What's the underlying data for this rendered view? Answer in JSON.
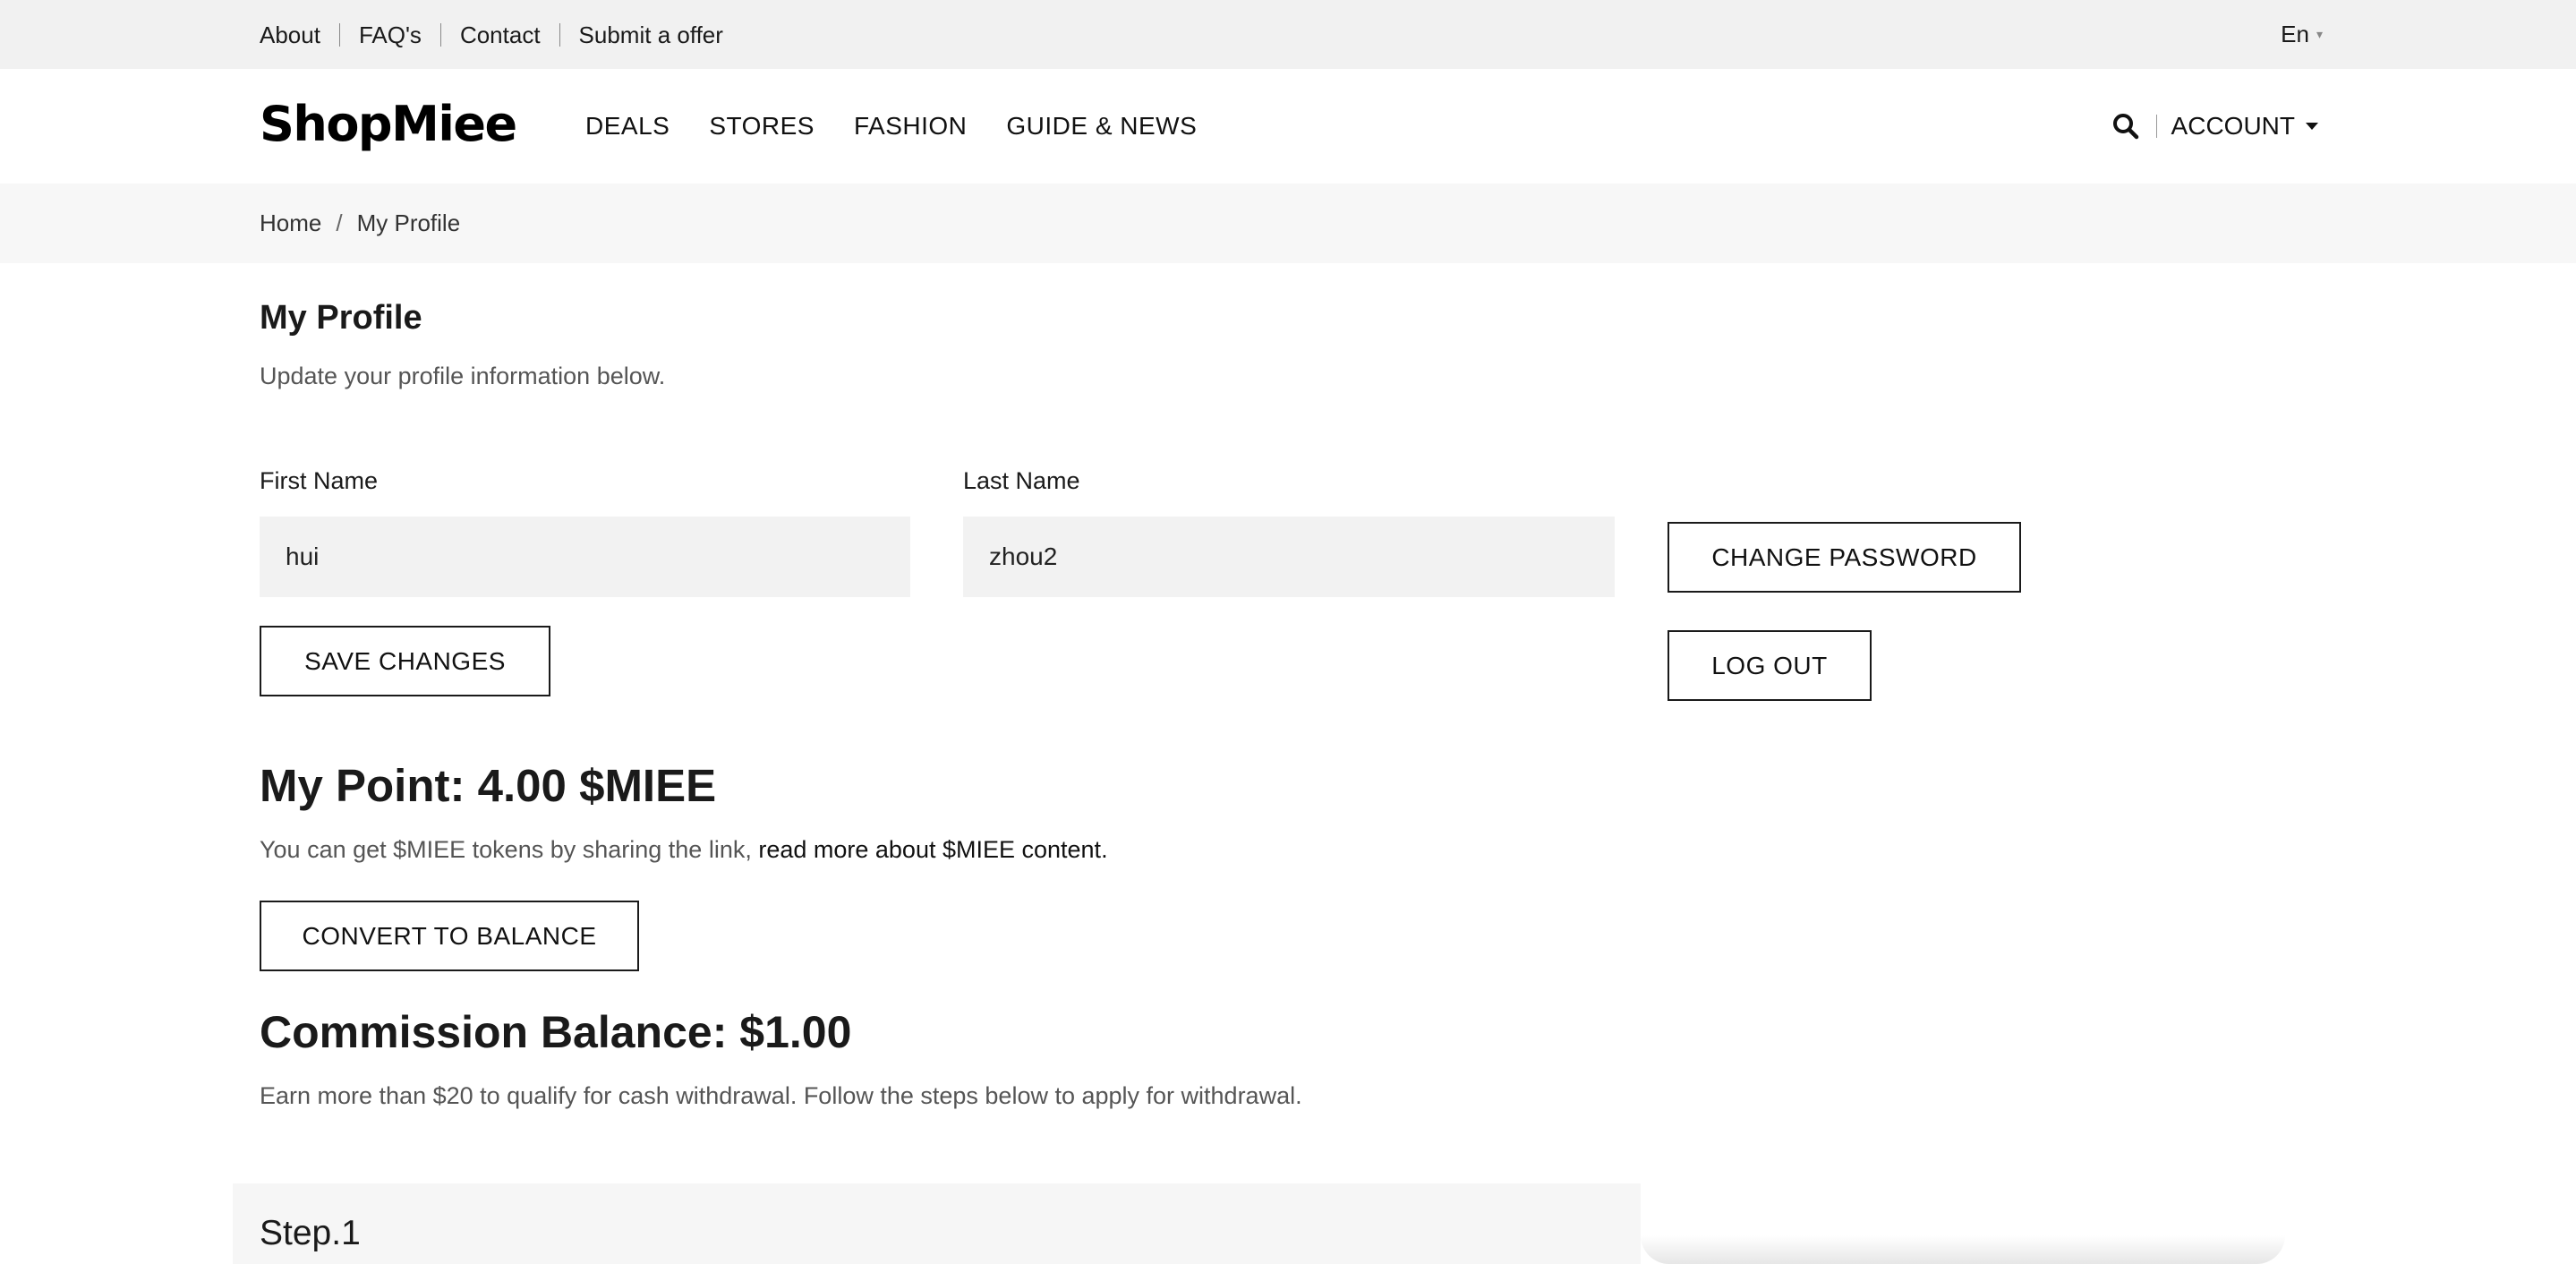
{
  "topbar": {
    "links": [
      "About",
      "FAQ's",
      "Contact",
      "Submit a offer"
    ],
    "language": "En"
  },
  "header": {
    "logo": "ShopMiee",
    "nav": [
      "DEALS",
      "STORES",
      "FASHION",
      "GUIDE & NEWS"
    ],
    "account_label": "ACCOUNT",
    "icons": [
      "search-icon",
      "caret-down-icon"
    ]
  },
  "breadcrumb": {
    "home": "Home",
    "separator": "/",
    "current": "My Profile"
  },
  "profile": {
    "title": "My Profile",
    "subtitle": "Update your profile information below.",
    "first_name_label": "First Name",
    "first_name_value": "hui",
    "last_name_label": "Last Name",
    "last_name_value": "zhou2",
    "save_button": "SAVE CHANGES",
    "change_password_button": "CHANGE PASSWORD",
    "logout_button": "LOG OUT"
  },
  "points": {
    "title": "My Point: 4.00 $MIEE",
    "text": "You can get $MIEE tokens by sharing the link, ",
    "link": "read more about $MIEE content.",
    "convert_button": "CONVERT TO BALANCE"
  },
  "commission": {
    "label": "Commission Balance: ",
    "amount": "$1.00",
    "text": "Earn more than $20 to qualify for cash withdrawal. Follow the steps below to apply for withdrawal."
  },
  "steps": {
    "first_title": "Step.1"
  },
  "colors": {
    "topbar_bg": "#f1f1f1",
    "breadcrumb_bg": "#f7f7f7",
    "input_bg": "#f2f2f2",
    "text": "#1a1a1a",
    "muted_text": "#555555"
  }
}
